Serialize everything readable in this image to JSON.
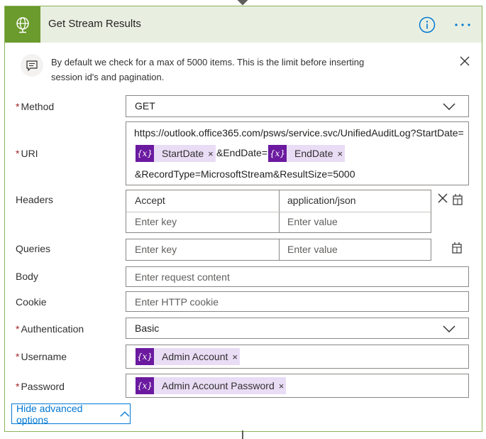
{
  "card": {
    "title": "Get Stream Results"
  },
  "notice": {
    "text": "By default we check for a max of 5000 items. This is the limit before inserting session id's and pagination."
  },
  "method": {
    "label": "Method",
    "value": "GET"
  },
  "uri": {
    "label": "URI",
    "prefix": "https://outlook.office365.com/psws/service.svc/UnifiedAuditLog?StartDate=",
    "token1": "StartDate",
    "middle": "&EndDate=",
    "token2": "EndDate",
    "suffix": "&RecordType=MicrosoftStream&ResultSize=5000"
  },
  "headers": {
    "label": "Headers",
    "rows": [
      {
        "key": "Accept",
        "value": "application/json"
      }
    ],
    "key_placeholder": "Enter key",
    "value_placeholder": "Enter value"
  },
  "queries": {
    "label": "Queries",
    "key_placeholder": "Enter key",
    "value_placeholder": "Enter value"
  },
  "body": {
    "label": "Body",
    "placeholder": "Enter request content"
  },
  "cookie": {
    "label": "Cookie",
    "placeholder": "Enter HTTP cookie"
  },
  "authentication": {
    "label": "Authentication",
    "value": "Basic"
  },
  "username": {
    "label": "Username",
    "token": "Admin Account"
  },
  "password": {
    "label": "Password",
    "token": "Admin Account Password"
  },
  "advanced": {
    "label": "Hide advanced options"
  },
  "common": {
    "required_mark": "*",
    "token_glyph": "{x}",
    "remove_glyph": "×"
  },
  "colors": {
    "header_bg": "#e9efe0",
    "icon_bg": "#6a9b2c",
    "accent": "#0078d4",
    "token_bg": "#e9dcf5",
    "token_icon_bg": "#6b1aa0",
    "required": "#a4262c"
  }
}
